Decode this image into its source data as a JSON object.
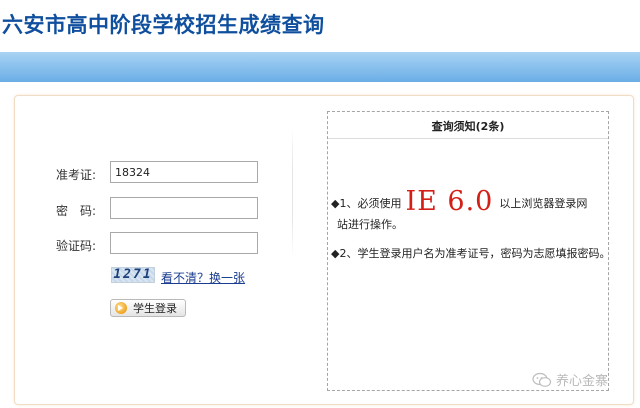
{
  "header": {
    "title": "六安市高中阶段学校招生成绩查询"
  },
  "login_form": {
    "ticket_label": "准考证:",
    "ticket_value": "18324",
    "password_label": "密　码:",
    "password_value": "",
    "captcha_label": "验证码:",
    "captcha_value": "",
    "captcha_image_text": "1271",
    "refresh_link": "看不清？换一张",
    "login_button": "学生登录"
  },
  "notice": {
    "title": "查询须知(2条)",
    "item1_prefix": "◆1、必须使用",
    "item1_highlight": "IE 6.0",
    "item1_suffix": "以上浏览器登录网",
    "item1_continued": "站进行操作。",
    "item2": "◆2、学生登录用户名为准考证号，密码为志愿填报密码。"
  },
  "watermark": {
    "text": "养心金寨",
    "icon": "wechat-icon"
  },
  "colors": {
    "title": "#0f4f9e",
    "band": "#8cc2ee",
    "highlight": "#d41f16",
    "panel_border": "#f1dcc5"
  }
}
